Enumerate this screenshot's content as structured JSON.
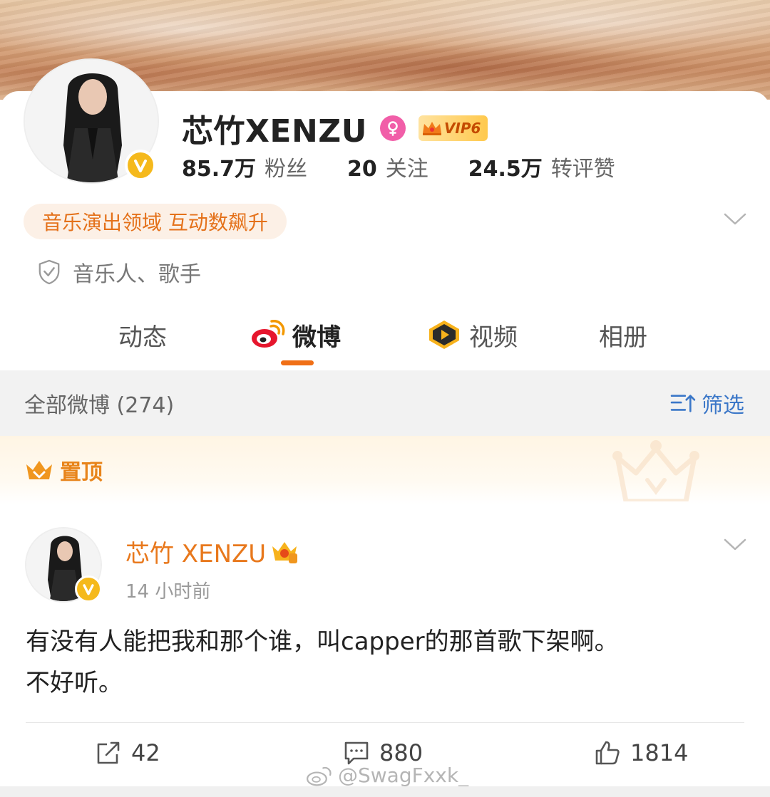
{
  "profile": {
    "name": "芯竹XENZU",
    "vip_label": "VIP6",
    "stats": [
      {
        "value": "85.7万",
        "label": "粉丝"
      },
      {
        "value": "20",
        "label": "关注"
      },
      {
        "value": "24.5万",
        "label": "转评赞"
      }
    ],
    "tag": "音乐演出领域 互动数飙升",
    "verification": "音乐人、歌手"
  },
  "tabs": [
    {
      "label": "动态",
      "icon": "none"
    },
    {
      "label": "微博",
      "icon": "weibo-logo-icon",
      "active": true
    },
    {
      "label": "视频",
      "icon": "video-play-icon"
    },
    {
      "label": "相册",
      "icon": "none"
    }
  ],
  "filter_bar": {
    "count_label": "全部微博 (274)",
    "filter_label": "筛选"
  },
  "pinned": {
    "label": "置顶"
  },
  "post": {
    "author": "芯竹 XENZU",
    "time": "14 小时前",
    "text_line1": "有没有人能把我和那个谁，叫capper的那首歌下架啊。",
    "text_line2": "不好听。",
    "actions": {
      "repost": "42",
      "comment": "880",
      "like": "1814"
    }
  },
  "watermark": "@SwagFxxk_",
  "colors": {
    "accent_orange": "#f06f16",
    "author_orange": "#e8781c",
    "filter_blue": "#3b77c8",
    "verified_gold": "#f5b91c",
    "gender_pink": "#f15ea8"
  }
}
